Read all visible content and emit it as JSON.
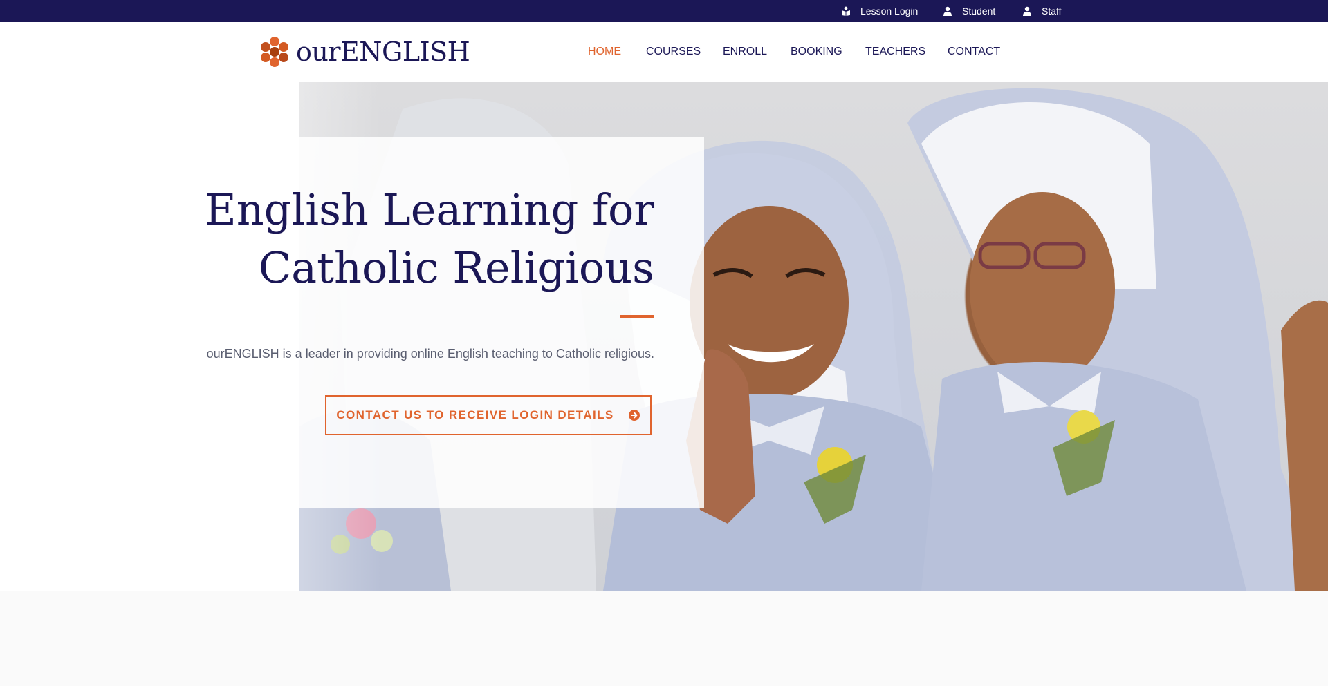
{
  "topbar": {
    "links": [
      {
        "label": "Lesson Login",
        "icon": "book-reader-icon"
      },
      {
        "label": "Student",
        "icon": "user-icon"
      },
      {
        "label": "Staff",
        "icon": "user-icon"
      }
    ]
  },
  "brand": {
    "name": "ourENGLISH",
    "logo_icon": "honeycomb-logo-icon",
    "colors": {
      "navy": "#1b1756",
      "accent": "#e0642e"
    }
  },
  "nav": {
    "items": [
      {
        "label": "HOME",
        "active": true
      },
      {
        "label": "COURSES",
        "active": false
      },
      {
        "label": "ENROLL",
        "active": false
      },
      {
        "label": "BOOKING",
        "active": false
      },
      {
        "label": "TEACHERS",
        "active": false
      },
      {
        "label": "CONTACT",
        "active": false
      }
    ]
  },
  "hero": {
    "title": "English Learning for Catholic Religious",
    "subtitle": "ourENGLISH is a leader in providing online English teaching to Catholic religious.",
    "cta_label": "CONTACT US TO RECEIVE LOGIN DETAILS",
    "cta_icon": "arrow-circle-right-icon",
    "image": "photo-of-smiling-nuns"
  }
}
